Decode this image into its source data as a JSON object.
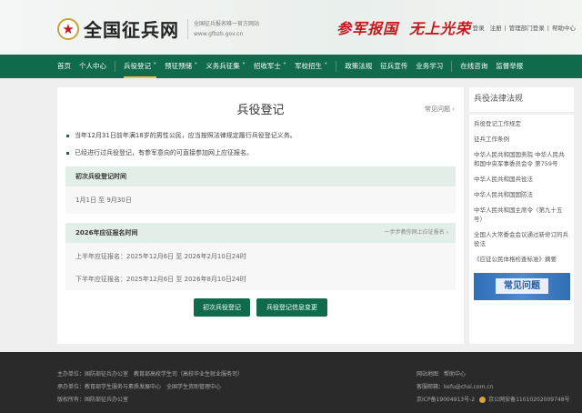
{
  "header": {
    "logo_text": "全国征兵网",
    "subtitle": "全国征兵报名唯一官方网站",
    "url": "www.gfbzb.gov.cn",
    "slogan": [
      "参军报国",
      "无上光荣"
    ],
    "links": [
      "登录",
      "注册",
      "管理部门登录",
      "帮助中心"
    ]
  },
  "nav": [
    "首页",
    "个人中心",
    "兵役登记 ˅",
    "预征预储 ˅",
    "义务兵征集 ˅",
    "招收军士 ˅",
    "军校招生 ˅",
    "政策法规",
    "征兵宣传",
    "业务学习",
    "在线咨询",
    "监督举报"
  ],
  "main": {
    "title": "兵役登记",
    "faq": "常见问题 ›",
    "bullets": [
      "当年12月31日前年满18岁的男性公民，应当按照法律规定履行兵役登记义务。",
      "已经进行过兵役登记，有参军意向的可直接参加网上应征报名。"
    ],
    "box1": {
      "header": "初次兵役登记时间",
      "line": "1月1日 至 9月30日"
    },
    "box2": {
      "header": "2026年应征报名时间",
      "link": "一步步教你网上应征报名 ›",
      "lines": [
        "上半年应征报名：2025年12月6日 至 2026年2月10日24时",
        "下半年应征报名：2025年12月6日 至 2026年8月10日24时"
      ]
    },
    "buttons": [
      "初次兵役登记",
      "兵役登记信息变更"
    ]
  },
  "sidebar": {
    "title": "兵役法律法规",
    "items": [
      "兵役登记工作规定",
      "征兵工作条例",
      "中华人民共和国国务院 中华人民共和国中央军事委员会令 第759号",
      "中华人民共和国兵役法",
      "中华人民共和国国防法",
      "中华人民共和国主席令（第九十五号）",
      "全国人大常委会会议通过新修订的兵役法",
      "《应征公民体格检查标准》摘要"
    ],
    "banner": "常见问题"
  },
  "footer": {
    "left": [
      "主办单位：国防部征兵办公室　教育部高校学生司（高校毕业生就业服务司）",
      "承办单位：教育部学生服务与素质发展中心　全国学生资助管理中心",
      "版权所有：国防部征兵办公室"
    ],
    "right": [
      "网站地图　帮助中心",
      "客服邮箱：kefu@chsi.com.cn"
    ],
    "icp": "京ICP备19004913号-2",
    "police": "京公网安备11010202009748号"
  }
}
